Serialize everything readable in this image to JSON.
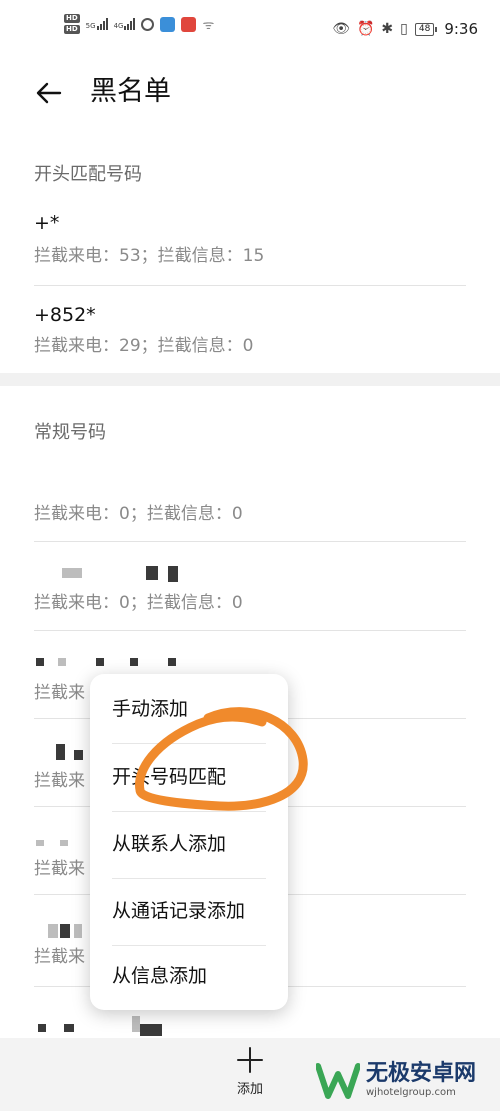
{
  "status_bar": {
    "hd_label": "HD",
    "net1": "5G",
    "net2": "4G",
    "battery": "48",
    "time": "9:36"
  },
  "app_bar": {
    "title": "黑名单"
  },
  "prefix_section": {
    "header": "开头匹配号码",
    "items": [
      {
        "number": "+*",
        "stats": "拦截来电：53；拦截信息：15"
      },
      {
        "number": "+852*",
        "stats": "拦截来电：29；拦截信息：0"
      }
    ]
  },
  "normal_section": {
    "header": "常规号码",
    "items": [
      {
        "stats": "拦截来电：0；拦截信息：0"
      },
      {
        "stats": "拦截来电：0；拦截信息：0"
      },
      {
        "stats": "拦截来"
      },
      {
        "stats": "拦截来"
      },
      {
        "stats": "拦截来"
      },
      {
        "stats": "拦截来"
      }
    ]
  },
  "popup_menu": {
    "items": [
      "手动添加",
      "开头号码匹配",
      "从联系人添加",
      "从通话记录添加",
      "从信息添加"
    ]
  },
  "bottom_bar": {
    "add_label": "添加"
  },
  "watermark": {
    "name": "无极安卓网",
    "url": "wjhotelgroup.com"
  },
  "colors": {
    "annotation": "#f08a2c",
    "divider": "#e3e3e3",
    "watermark_green": "#3aa655",
    "watermark_blue": "#1b3a6b"
  }
}
